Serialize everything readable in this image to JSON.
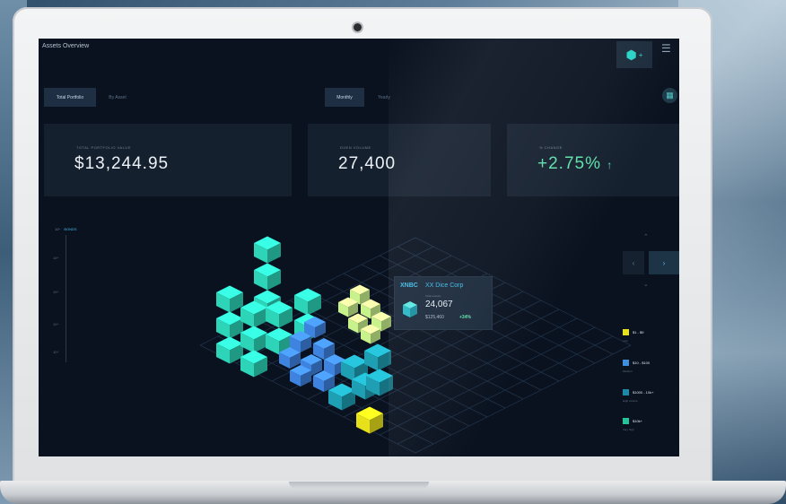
{
  "window": {
    "title": "Assets Overview"
  },
  "tabs": [
    {
      "label": "Total Portfolio",
      "active": true
    },
    {
      "label": "By Asset",
      "active": false
    }
  ],
  "period_tabs": [
    {
      "label": "Monthly",
      "active": true
    },
    {
      "label": "Yearly",
      "active": false
    }
  ],
  "cards": [
    {
      "label": "TOTAL PORTFOLIO VALUE",
      "value": "$13,244.95"
    },
    {
      "label": "DVEN VOLUME",
      "value": "27,400"
    },
    {
      "label": "% CHANGE",
      "value": "+2.75%",
      "trend": "↑"
    }
  ],
  "chart": {
    "legend_label": "10^",
    "legend_unit": "BONDS",
    "y_ticks": [
      "10^",
      "10^",
      "10^",
      "10^",
      "10^"
    ]
  },
  "tooltip": {
    "ticker": "XNBC",
    "company": "XX Dice Corp",
    "sub": "Total amount",
    "value": "24,067",
    "price": "$125,460",
    "change": "+34%"
  },
  "legend": [
    {
      "label": "$1 - $9",
      "sub": "Low",
      "color": "#e6e11a"
    },
    {
      "label": "$10 - $100",
      "sub": "Medium",
      "color": "#3f8fdf"
    },
    {
      "label": "$1000 - 10k+",
      "sub": "High volume",
      "color": "#1c8aa6"
    },
    {
      "label": "$10k+",
      "sub": "Very high",
      "color": "#24c39a"
    }
  ],
  "colors": {
    "teal": "#2dd4b8",
    "blue": "#3f83e0",
    "lime": "#c8f28c",
    "yellow": "#e6e11a",
    "accent_green": "#5fe0a9"
  },
  "icons": {
    "top_right": "cube-add-icon",
    "top_right_2": "layers-icon",
    "calendar": "calendar-icon"
  }
}
